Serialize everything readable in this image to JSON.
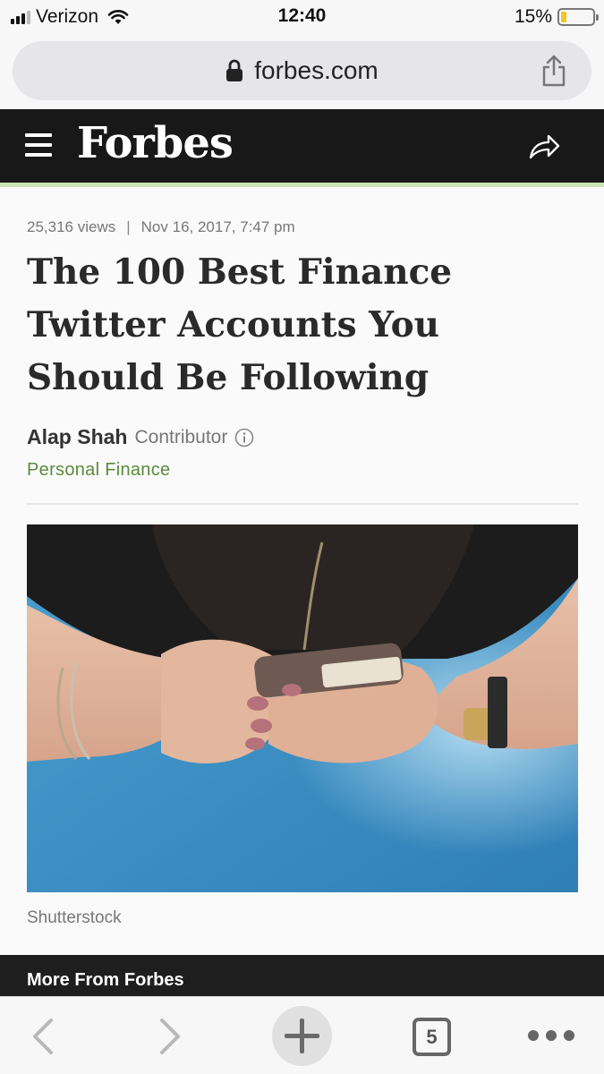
{
  "status_bar": {
    "carrier": "Verizon",
    "time": "12:40",
    "battery_percent": "15%",
    "battery_level": 0.15
  },
  "url_bar": {
    "domain": "forbes.com"
  },
  "site_header": {
    "logo": "Forbes"
  },
  "article": {
    "views": "25,316 views",
    "separator": "|",
    "date": "Nov 16, 2017, 7:47 pm",
    "headline": "The 100 Best Finance Twitter Accounts You Should Be Following",
    "author": "Alap Shah",
    "author_role": "Contributor",
    "channel": "Personal Finance",
    "image_caption": "Shutterstock"
  },
  "more_bar": {
    "title": "More From Forbes"
  },
  "toolbar": {
    "tab_count": "5"
  },
  "colors": {
    "header_bg": "#181818",
    "header_underline": "#c9e4b4",
    "channel_green": "#5b8a3c",
    "battery_low": "#f3c623"
  },
  "icons": [
    "signal-icon",
    "wifi-icon",
    "battery-icon",
    "lock-icon",
    "share-icon",
    "hamburger-icon",
    "forward-share-icon",
    "info-icon",
    "back-icon",
    "forward-icon",
    "new-tab-icon",
    "tabs-icon",
    "more-icon"
  ]
}
